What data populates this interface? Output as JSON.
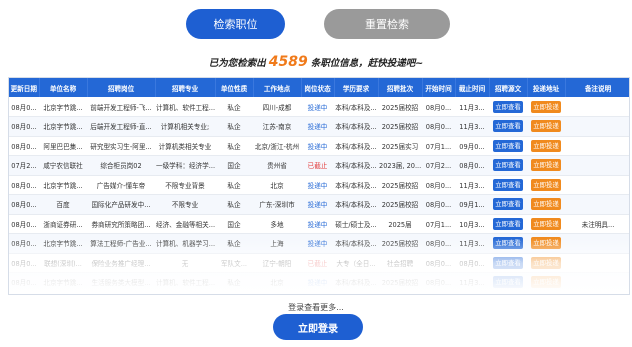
{
  "top_buttons": {
    "search_label": "检索职位",
    "reset_label": "重置检索"
  },
  "result": {
    "prefix": "已为您检索出",
    "count": "4589",
    "suffix": "条职位信息，赶快投递吧~"
  },
  "table": {
    "headers": [
      "更新日期",
      "单位名称",
      "招聘岗位",
      "招聘专业",
      "单位性质",
      "工作地点",
      "岗位状态",
      "学历要求",
      "招聘批次",
      "开始时间",
      "截止时间",
      "招聘源文",
      "投递地址",
      "备注说明"
    ],
    "rows": [
      [
        "08月0...",
        "北京字节跳...",
        "前端开发工程师-飞...",
        "计算机、软件工程...",
        "私企",
        "四川-成都",
        "投递中",
        "本科/本科及...",
        "2025届校招",
        "08月0...",
        "11月3...",
        "立即查看",
        "立即投递",
        ""
      ],
      [
        "08月0...",
        "北京字节跳...",
        "后端开发工程师-直...",
        "计算机相关专业;",
        "私企",
        "江苏-南京",
        "投递中",
        "本科/本科及...",
        "2025届校招",
        "08月0...",
        "11月3...",
        "立即查看",
        "立即投递",
        ""
      ],
      [
        "08月0...",
        "阿里巴巴集...",
        "研究型实习生-阿里...",
        "计算机类相关专业",
        "私企",
        "北京/浙江-杭州",
        "投递中",
        "本科/本科及...",
        "2025届实习",
        "07月1...",
        "09月0...",
        "立即查看",
        "立即投递",
        ""
      ],
      [
        "07月2...",
        "咸宁农信联社",
        "综合柜员岗02",
        "一级学科：经济学...",
        "国企",
        "贵州省",
        "已截止",
        "本科/本科及...",
        "2023届, 20...",
        "07月2...",
        "08月0...",
        "立即查看",
        "立即投递",
        ""
      ],
      [
        "08月0...",
        "北京字节跳...",
        "广告媒介-懂车帝",
        "不限专业背景",
        "私企",
        "北京",
        "投递中",
        "本科/本科及...",
        "2025届校招",
        "08月0...",
        "11月3...",
        "立即查看",
        "立即投递",
        ""
      ],
      [
        "08月0...",
        "百度",
        "国际化产品研发中...",
        "不限专业",
        "私企",
        "广东-深圳市",
        "投递中",
        "本科/本科及...",
        "2025届校招",
        "08月0...",
        "09月1...",
        "立即查看",
        "立即投递",
        ""
      ],
      [
        "08月0...",
        "浙商证券研...",
        "券商研究所策略团...",
        "经济、金融等相关...",
        "国企",
        "多地",
        "投递中",
        "硕士/硕士及...",
        "2025届",
        "07月1...",
        "10月3...",
        "立即查看",
        "立即投递",
        "未注明具..."
      ],
      [
        "08月0...",
        "北京字节跳...",
        "算法工程师-广告业...",
        "计算机、机器学习...",
        "私企",
        "上海",
        "投递中",
        "本科/本科及...",
        "2025届校招",
        "08月0...",
        "11月3...",
        "立即查看",
        "立即投递",
        ""
      ],
      [
        "08月0...",
        "联想(深圳)...",
        "保险业务推广经理...",
        "无",
        "军队文...",
        "辽宁-朝阳",
        "已截止",
        "大专（全日...",
        "社会招聘",
        "08月0...",
        "08月0...",
        "立即查看",
        "立即投递",
        ""
      ],
      [
        "08月0...",
        "北京字节跳...",
        "生活服务类大模型...",
        "计算机、软件工程...",
        "私企",
        "北京",
        "投递中",
        "本科/本科及...",
        "2025届校招",
        "08月0...",
        "11月3...",
        "立即查看",
        "立即投递",
        ""
      ]
    ]
  },
  "footer": {
    "hint": "登录查看更多...",
    "login_label": "立即登录"
  }
}
